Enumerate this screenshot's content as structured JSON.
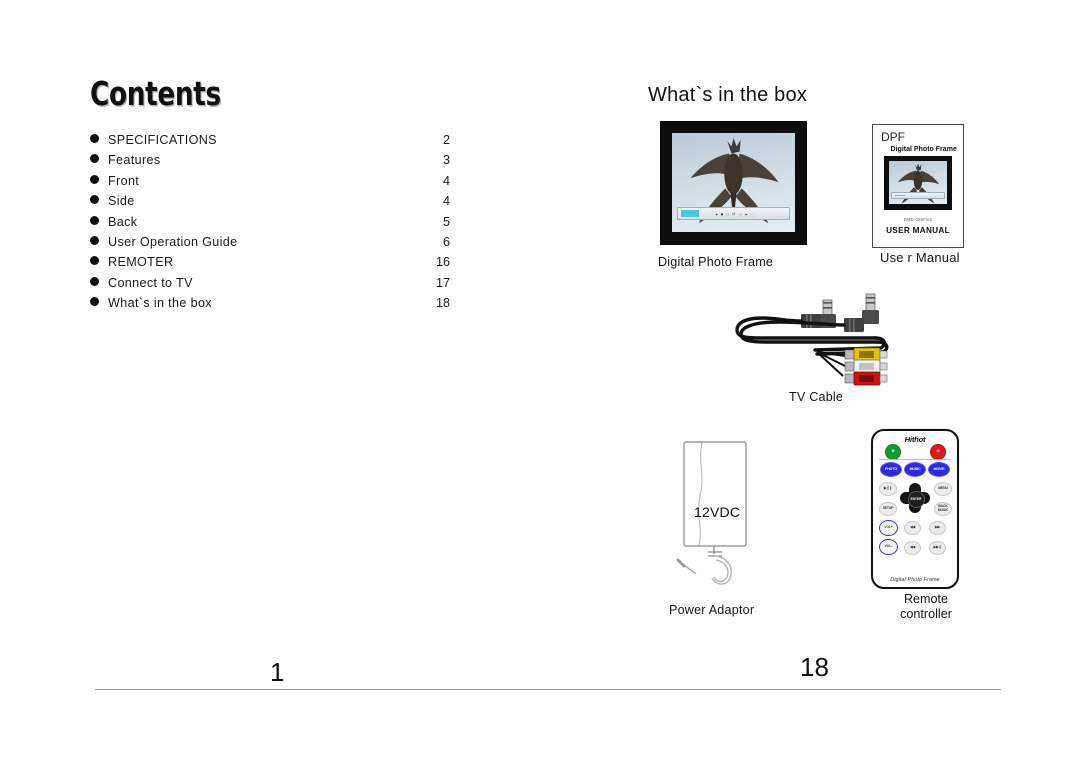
{
  "left_page": {
    "title": "Contents",
    "toc": [
      {
        "label": "SPECIFICATIONS",
        "page": "2"
      },
      {
        "label": "Features",
        "page": "3"
      },
      {
        "label": "Front",
        "page": "4"
      },
      {
        "label": "Side",
        "page": "4"
      },
      {
        "label": "Back",
        "page": "5"
      },
      {
        "label": "User Operation  Guide",
        "page": "6"
      },
      {
        "label": "REMOTER",
        "page": "16"
      },
      {
        "label": "Connect to TV",
        "page": "17"
      },
      {
        "label": "What`s in the box",
        "page": "18"
      }
    ],
    "page_number": "1"
  },
  "right_page": {
    "title": "What`s in the box",
    "page_number": "18",
    "items": {
      "photo_frame": {
        "caption": "Digital Photo Frame",
        "osd_text": "▸ ■ □ ↺ ↔ ▸ ⬜"
      },
      "user_manual": {
        "caption": "Use r Manual",
        "cover_title": "DPF",
        "cover_subtitle": "Digital Photo Frame",
        "cover_code": "DMD-028F/e2",
        "cover_label": "USER MANUAL"
      },
      "tv_cable": {
        "caption": "TV Cable",
        "rca_colors": [
          "#e8c400",
          "#e8e8e8",
          "#cc1111"
        ]
      },
      "power_adaptor": {
        "caption": "Power Adaptor",
        "voltage_label": "12VDC"
      },
      "remote": {
        "caption": "Remote\ncontroller",
        "caption_line1": "Remote",
        "caption_line2": "controller",
        "brand": "Hithot",
        "footer": "Digital Photo Frame",
        "buttons": {
          "mute": "Ø",
          "power": "⏻",
          "photo": "PHOTO",
          "music": "MUSIC",
          "movie": "MOVIE",
          "play_pause": "▶❙❙",
          "menu": "MENU",
          "up": "▲",
          "left": "◀",
          "enter": "ENTER",
          "right": "▶",
          "down": "▼",
          "setup": "SETUP",
          "back_music": "BACK MUSIC",
          "vol_up": "VOL+",
          "vol_down": "VOL-",
          "prev": "◀◀",
          "next": "▶▶",
          "rewind": "◀◀",
          "forward": "▶▶❙"
        }
      }
    }
  },
  "colors": {
    "ink": "#111111",
    "rule": "#9a9a9a",
    "remote_blue": "#2a2ae0",
    "remote_green": "#149b2e",
    "remote_red": "#d91b1b"
  }
}
